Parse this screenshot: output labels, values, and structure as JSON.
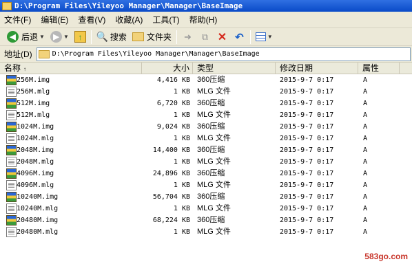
{
  "window": {
    "title": "D:\\Program Files\\Yileyoo Manager\\Manager\\BaseImage",
    "icon": "folder-icon"
  },
  "menubar": {
    "items": [
      "文件(F)",
      "编辑(E)",
      "查看(V)",
      "收藏(A)",
      "工具(T)",
      "帮助(H)"
    ]
  },
  "toolbar": {
    "back_label": "后退",
    "search_label": "搜索",
    "folders_label": "文件夹"
  },
  "address": {
    "label": "地址(D)",
    "value": "D:\\Program Files\\Yileyoo Manager\\Manager\\BaseImage"
  },
  "columns": {
    "name": "名称",
    "size": "大小",
    "type": "类型",
    "modified": "修改日期",
    "attributes": "属性"
  },
  "files": [
    {
      "name": "256M.img",
      "size": "4,416 KB",
      "type": "360压缩",
      "modified": "2015-9-7 0:17",
      "attr": "A",
      "icon": "archive-icon"
    },
    {
      "name": "256M.mlg",
      "size": "1 KB",
      "type": "MLG 文件",
      "modified": "2015-9-7 0:17",
      "attr": "A",
      "icon": "document-icon"
    },
    {
      "name": "512M.img",
      "size": "6,720 KB",
      "type": "360压缩",
      "modified": "2015-9-7 0:17",
      "attr": "A",
      "icon": "archive-icon"
    },
    {
      "name": "512M.mlg",
      "size": "1 KB",
      "type": "MLG 文件",
      "modified": "2015-9-7 0:17",
      "attr": "A",
      "icon": "document-icon"
    },
    {
      "name": "1024M.img",
      "size": "9,024 KB",
      "type": "360压缩",
      "modified": "2015-9-7 0:17",
      "attr": "A",
      "icon": "archive-icon"
    },
    {
      "name": "1024M.mlg",
      "size": "1 KB",
      "type": "MLG 文件",
      "modified": "2015-9-7 0:17",
      "attr": "A",
      "icon": "document-icon"
    },
    {
      "name": "2048M.img",
      "size": "14,400 KB",
      "type": "360压缩",
      "modified": "2015-9-7 0:17",
      "attr": "A",
      "icon": "archive-icon"
    },
    {
      "name": "2048M.mlg",
      "size": "1 KB",
      "type": "MLG 文件",
      "modified": "2015-9-7 0:17",
      "attr": "A",
      "icon": "document-icon"
    },
    {
      "name": "4096M.img",
      "size": "24,896 KB",
      "type": "360压缩",
      "modified": "2015-9-7 0:17",
      "attr": "A",
      "icon": "archive-icon"
    },
    {
      "name": "4096M.mlg",
      "size": "1 KB",
      "type": "MLG 文件",
      "modified": "2015-9-7 0:17",
      "attr": "A",
      "icon": "document-icon"
    },
    {
      "name": "10240M.img",
      "size": "56,704 KB",
      "type": "360压缩",
      "modified": "2015-9-7 0:17",
      "attr": "A",
      "icon": "archive-icon"
    },
    {
      "name": "10240M.mlg",
      "size": "1 KB",
      "type": "MLG 文件",
      "modified": "2015-9-7 0:17",
      "attr": "A",
      "icon": "document-icon"
    },
    {
      "name": "20480M.img",
      "size": "68,224 KB",
      "type": "360压缩",
      "modified": "2015-9-7 0:17",
      "attr": "A",
      "icon": "archive-icon"
    },
    {
      "name": "20480M.mlg",
      "size": "1 KB",
      "type": "MLG 文件",
      "modified": "2015-9-7 0:17",
      "attr": "A",
      "icon": "document-icon"
    }
  ],
  "watermark": "583go.com",
  "colors": {
    "titlebar": "#0a4bc8",
    "chrome": "#ece9d8",
    "header": "#ebeadb"
  }
}
